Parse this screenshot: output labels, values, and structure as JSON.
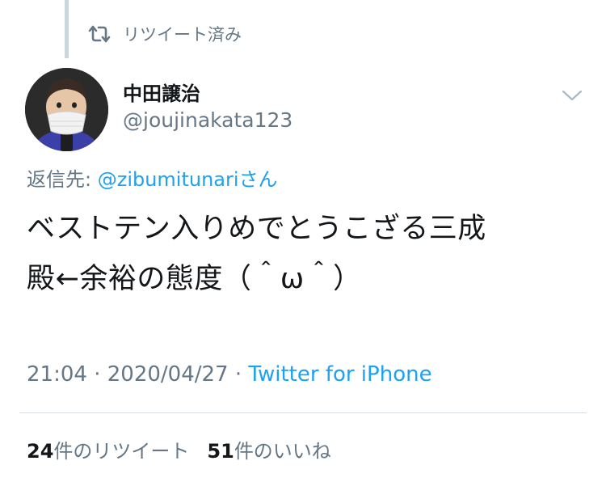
{
  "retweet": {
    "label": "リツイート済み",
    "icon": "retweet-icon"
  },
  "user": {
    "display_name": "中田譲治",
    "handle": "@joujinakata123"
  },
  "reply": {
    "prefix": "返信先: ",
    "mention": "@zibumitunari",
    "suffix": "さん"
  },
  "tweet": {
    "line1": "ベストテン入りめでとうこざる三成",
    "line2": "殿←余裕の態度（＾ω＾）"
  },
  "meta": {
    "time": "21:04",
    "sep1": " · ",
    "date": "2020/04/27",
    "sep2": " · ",
    "source": "Twitter for iPhone"
  },
  "stats": {
    "retweets_count": "24",
    "retweets_label": "件のリツイート",
    "likes_count": "51",
    "likes_label": "件のいいね"
  },
  "colors": {
    "accent": "#1da1f2",
    "secondary_text": "#657786",
    "primary_text": "#14171a"
  }
}
